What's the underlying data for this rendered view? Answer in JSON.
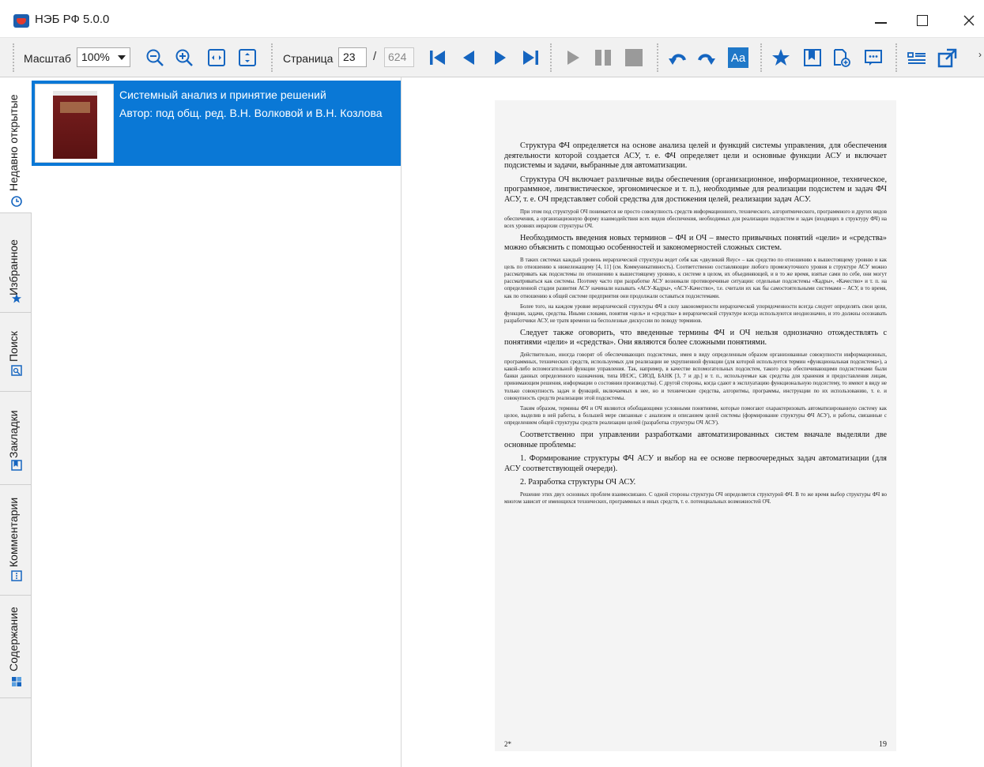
{
  "window": {
    "title": "НЭБ РФ 5.0.0"
  },
  "toolbar": {
    "zoom_label": "Масштаб",
    "zoom_value": "100%",
    "page_label": "Страница",
    "page_current": "23",
    "page_separator": "/",
    "page_total": "624",
    "font_toggle_label": "Aa",
    "accent_color": "#0a78d6"
  },
  "sidebar": {
    "tabs": [
      {
        "label": "Недавно открытые",
        "icon": "clock-icon"
      },
      {
        "label": "Избранное",
        "icon": "star-icon"
      },
      {
        "label": "Поиск",
        "icon": "search-icon"
      },
      {
        "label": "Закладки",
        "icon": "bookmark-icon"
      },
      {
        "label": "Комментарии",
        "icon": "comment-icon"
      },
      {
        "label": "Содержание",
        "icon": "contents-icon"
      }
    ],
    "active_tab": "Недавно открытые"
  },
  "recent": {
    "items": [
      {
        "title": "Системный анализ и принятие решений",
        "author": "Автор: под общ. ред. В.Н. Волковой и В.Н. Козлова"
      }
    ]
  },
  "document_page": {
    "paragraphs": [
      {
        "style": "big",
        "text": "Структура ФЧ определяется на основе анализа целей и функций системы управления, для обеспечения деятельности которой создается АСУ, т. е. ФЧ определяет цели и основные функции АСУ и включает подсистемы и задачи, выбранные для автоматизации."
      },
      {
        "style": "big",
        "text": "Структура ОЧ включает различные виды обеспечения (организационное, информационное, техническое, программное, лингвистическое, эргономическое и т. п.), необходимые для реализации подсистем и задач ФЧ АСУ, т. е. ОЧ представляет собой средства для достижения целей, реализации задач АСУ."
      },
      {
        "style": "small",
        "text": "При этом под структурой ОЧ понимается не просто совокупность средств информационного, технического, алгоритмического, программного и других видов обеспечения, а организационную форму взаимодействия всех видов обеспечения, необходимых для реализации подсистем и задач (входящих в структуру ФЧ) на всех уровнях иерархии структуры ОЧ."
      },
      {
        "style": "big",
        "text": "Необходимость введения новых терминов – ФЧ и ОЧ – вместо привычных понятий «цели» и «средства» можно объяснить с помощью особенностей и закономерностей сложных систем."
      },
      {
        "style": "small",
        "text": "В таких системах каждый уровень иерархической структуры ведет себя как «двуликий Янус» – как средство по отношению к вышестоящему уровню и как цель по отношению к нижележащему [4, 11] (см. Коммуникативность). Соответственно составляющие любого промежуточного уровня в структуре АСУ можно рассматривать как подсистемы по отношению к вышестоящему уровню, к системе в целом, их объединяющей, и в то же время, взятые сами по себе, они могут рассматриваться как системы. Поэтому часто при разработке АСУ возникали противоречивые ситуации: отдельные подсистемы «Кадры», «Качество» и т. п. на определенной стадии развития АСУ начинали называть «АСУ-Кадры», «АСУ-Качество», т.е. считали их как бы самостоятельными системами – АСУ, в то время, как по отношению к общей системе предприятия они продолжали оставаться подсистемами."
      },
      {
        "style": "small",
        "text": "Более того, на каждом уровне иерархической структуры ФЧ в силу закономерности иерархической упорядоченности всегда следует определять свои цели, функции, задачи, средства. Иными словами, понятия «цель» и «средства» в иерархической структуре всегда используются неоднозначно, и это должны осознавать разработчики АСУ, не тратя времени на бесполезные дискуссии по поводу терминов."
      },
      {
        "style": "big",
        "text": "Следует также оговорить, что введенные термины ФЧ и ОЧ нельзя однозначно отождествлять с понятиями «цели» и «средства». Они являются более сложными понятиями."
      },
      {
        "style": "small",
        "text": "Действительно, иногда говорят об обеспечивающих подсистемах, имея в виду определенным образом организованные совокупности информационных, программных, технических средств, используемых для реализации не укрупненной функции (для которой используется термин «функциональная подсистема»), а какой-либо вспомогательной функции управления. Так, например, в качестве вспомогательных подсистем, такого рода обеспечивающими подсистемами были банки данных определенного назначения, типа ИНЭС, СИОД, БАНК [3, 7 и др.] и т. п., используемые как средства для хранения и предоставления лицам, принимающим решения, информации о состоянии производства). С другой стороны, когда сдают в эксплуатацию функциональную подсистему, то имеют в виду не только совокупность задач и функций, включаемых в нее, но и технические средства, алгоритмы, программы, инструкции по их использованию, т. е. и совокупность средств реализации этой подсистемы."
      },
      {
        "style": "small",
        "text": "Таким образом, термины ФЧ и ОЧ являются обобщающими условными понятиями, которые помогают охарактеризовать автоматизированную систему как целое, выделив в ней работы, в большей мере связанные с анализом и описанием целей системы (формирование структуры ФЧ АСУ), и работы, связанные с определением общей структуры средств реализации целей (разработка структуры ОЧ АСУ)."
      },
      {
        "style": "big",
        "text": "Соответственно при управлении разработками автоматизированных систем вначале выделяли две основные проблемы:"
      },
      {
        "style": "big",
        "text": "1. Формирование структуры ФЧ АСУ и выбор на ее основе первоочередных задач автоматизации (для АСУ соответствующей очереди)."
      },
      {
        "style": "big",
        "text": "2. Разработка структуры ОЧ АСУ."
      },
      {
        "style": "small",
        "text": "Решение этих двух основных проблем взаимосвязано. С одной стороны структура ОЧ определяется структурой ФЧ. В то же время выбор структуры ФЧ во многом зависит от имеющихся технических, программных и иных средств, т. е. потенциальных возможностей ОЧ."
      }
    ],
    "footer_left": "2*",
    "footer_right": "19"
  }
}
